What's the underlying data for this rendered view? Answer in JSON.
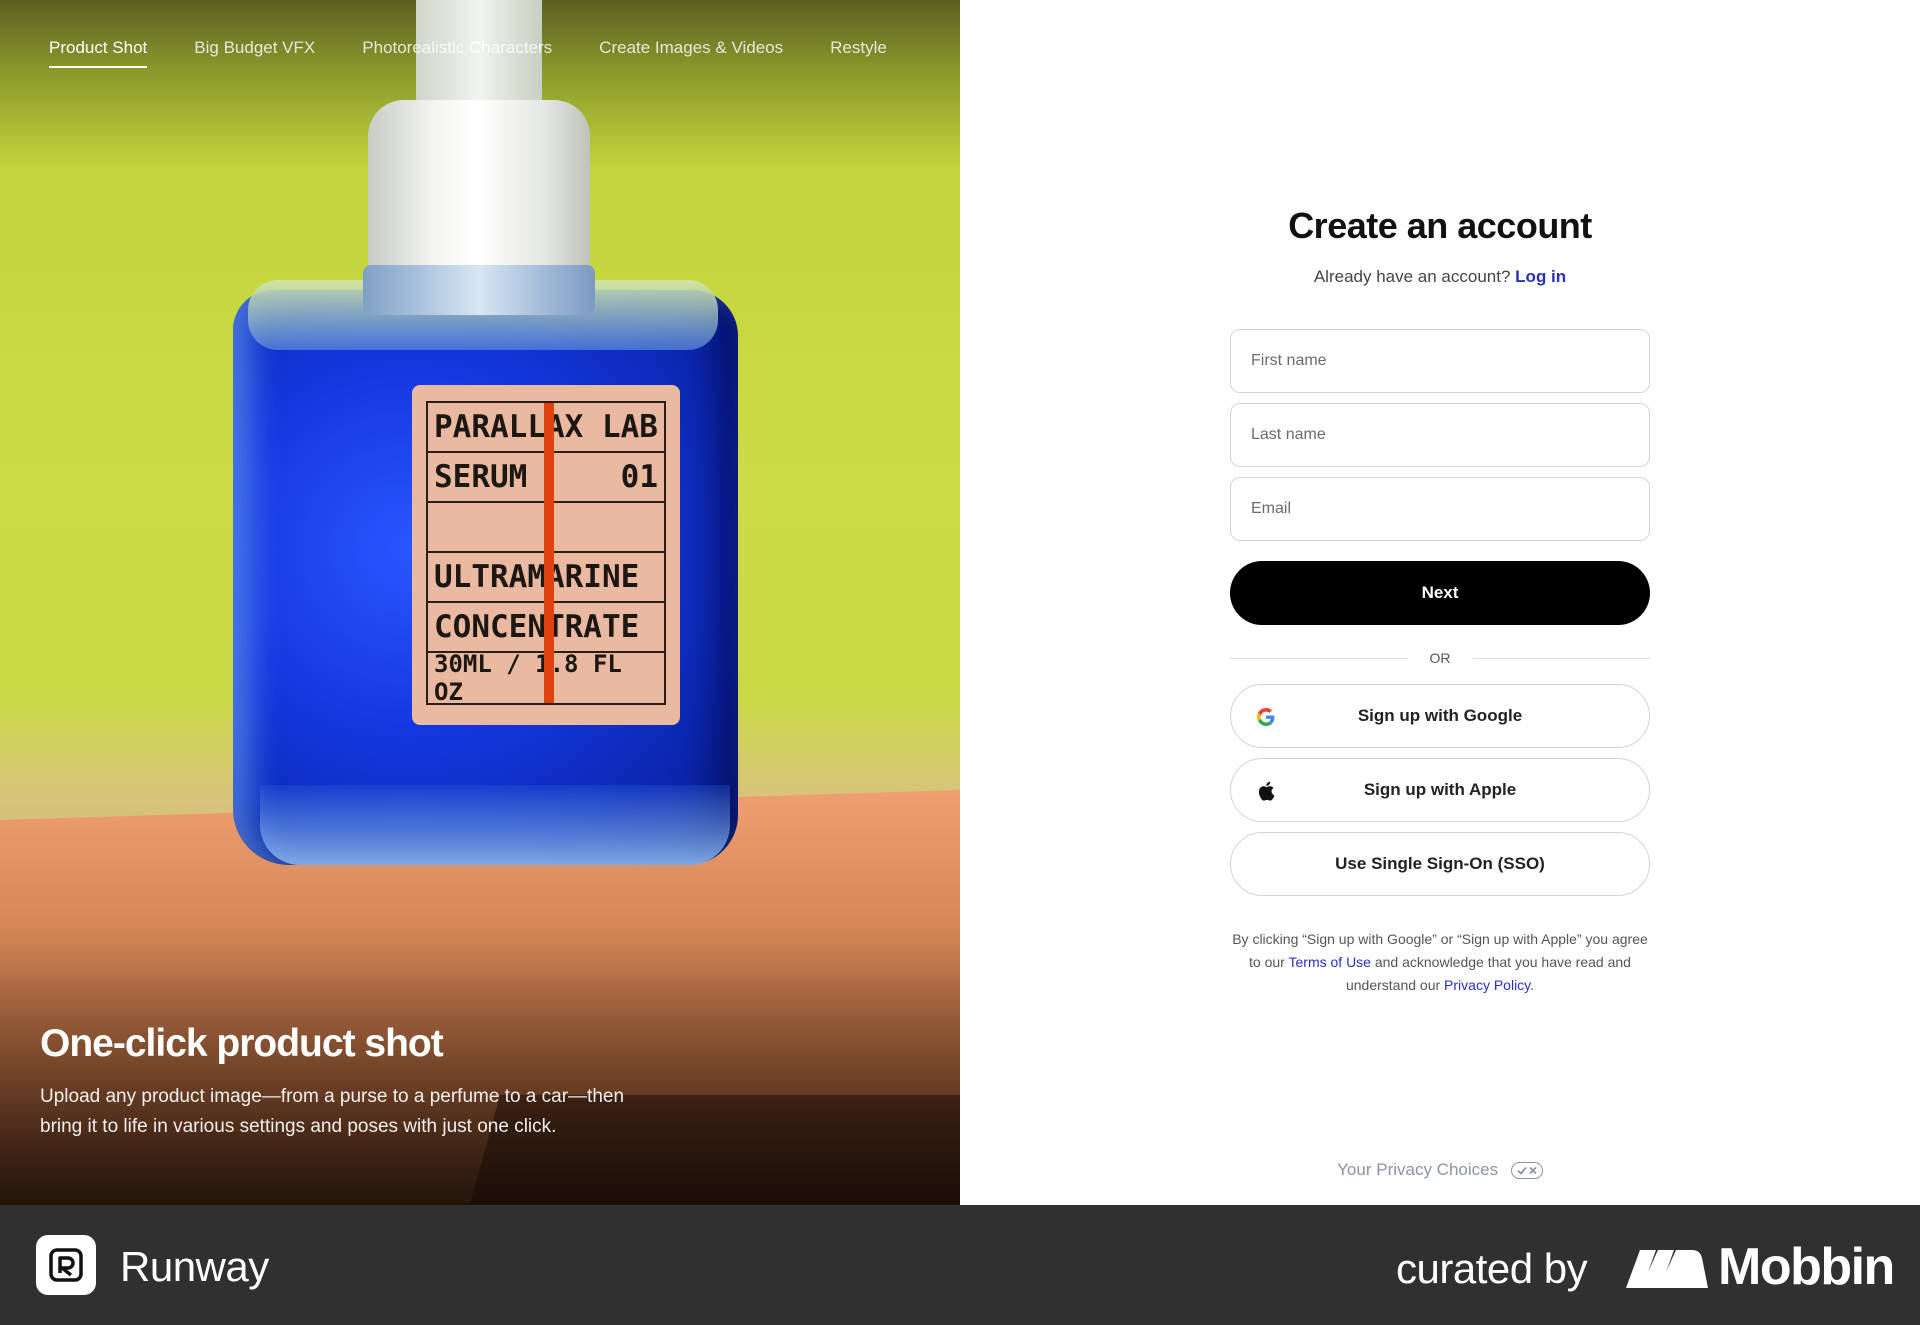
{
  "hero": {
    "nav": [
      {
        "label": "Product Shot",
        "active": true
      },
      {
        "label": "Big Budget VFX",
        "active": false
      },
      {
        "label": "Photorealistic Characters",
        "active": false
      },
      {
        "label": "Create Images & Videos",
        "active": false
      },
      {
        "label": "Restyle",
        "active": false
      }
    ],
    "bottle_label": {
      "line1_left": "PARALLAX LAB",
      "line2_left": "SERUM",
      "line2_right": "01",
      "line3": "ULTRAMARINE",
      "line4": "CONCENTRATE",
      "line5": "30ML / 1.8 FL OZ"
    },
    "title": "One-click product shot",
    "description": "Upload any product image—from a purse to a perfume to a car—then bring it to life in various settings and poses with just one click."
  },
  "form": {
    "title": "Create an account",
    "login_prompt": "Already have an account?",
    "login_link": "Log in",
    "first_name_placeholder": "First name",
    "last_name_placeholder": "Last name",
    "email_placeholder": "Email",
    "next_label": "Next",
    "or_label": "OR",
    "google_label": "Sign up with Google",
    "apple_label": "Sign up with Apple",
    "sso_label": "Use Single Sign-On (SSO)",
    "legal_part1": "By clicking “Sign up with Google” or “Sign up with Apple” you agree to our",
    "legal_terms": "Terms of Use",
    "legal_part2": "and acknowledge that you have read and understand our",
    "legal_privacy": "Privacy Policy",
    "legal_end": ".",
    "privacy_choices": "Your Privacy Choices"
  },
  "footer": {
    "brand": "Runway",
    "curated_by": "curated by",
    "mobbin": "Mobbin"
  },
  "colors": {
    "link": "#2b2fbf",
    "button_bg": "#000000",
    "footer_bg": "#303030"
  }
}
